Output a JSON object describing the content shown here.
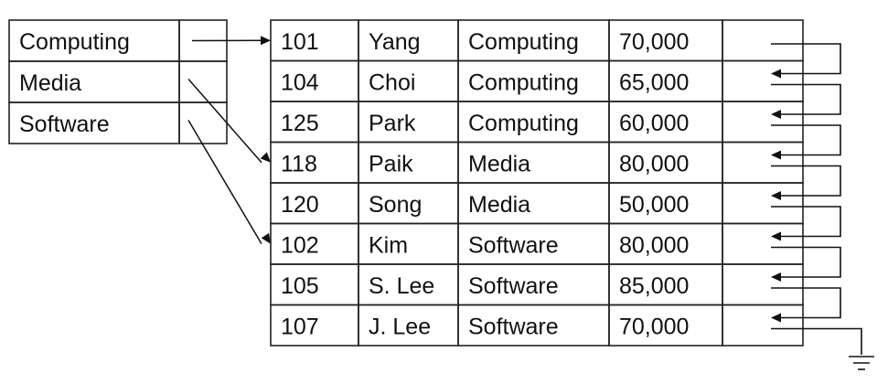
{
  "index": {
    "entries": [
      "Computing",
      "Media",
      "Software"
    ]
  },
  "records": [
    {
      "id": "101",
      "name": "Yang",
      "dept": "Computing",
      "salary": "70,000"
    },
    {
      "id": "104",
      "name": "Choi",
      "dept": "Computing",
      "salary": "65,000"
    },
    {
      "id": "125",
      "name": "Park",
      "dept": "Computing",
      "salary": "60,000"
    },
    {
      "id": "118",
      "name": "Paik",
      "dept": "Media",
      "salary": "80,000"
    },
    {
      "id": "120",
      "name": "Song",
      "dept": "Media",
      "salary": "50,000"
    },
    {
      "id": "102",
      "name": "Kim",
      "dept": "Software",
      "salary": "80,000"
    },
    {
      "id": "105",
      "name": "S. Lee",
      "dept": "Software",
      "salary": "85,000"
    },
    {
      "id": "107",
      "name": "J. Lee",
      "dept": "Software",
      "salary": "70,000"
    }
  ],
  "index_targets": [
    0,
    3,
    5
  ],
  "colors": {
    "line": "#111111",
    "border": "#222222",
    "text": "#111111",
    "background": "#ffffff"
  }
}
